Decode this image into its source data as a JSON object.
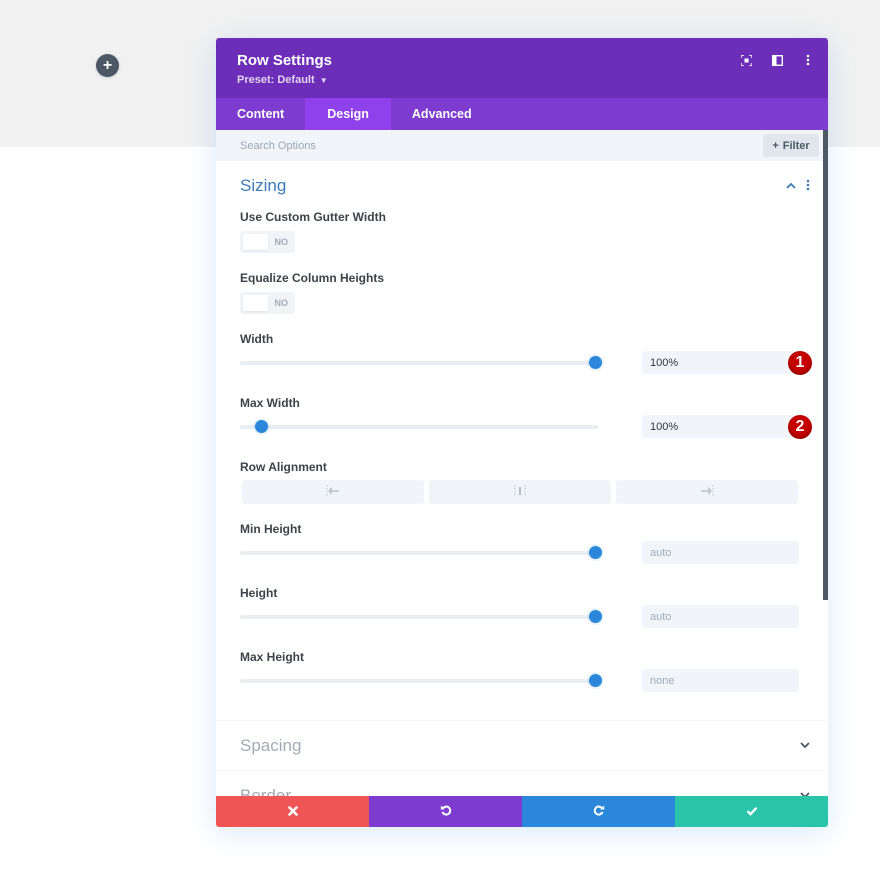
{
  "canvas": {
    "add_row_icon": "plus-icon"
  },
  "panel": {
    "title": "Row Settings",
    "preset_label": "Preset: Default",
    "header_icons": [
      "focus-mode-icon",
      "split-view-icon",
      "more-options-icon"
    ],
    "tabs": [
      {
        "label": "Content",
        "active": false
      },
      {
        "label": "Design",
        "active": true
      },
      {
        "label": "Advanced",
        "active": false
      }
    ],
    "search": {
      "placeholder": "Search Options",
      "value": ""
    },
    "filter_label": "Filter",
    "colors": {
      "header": "#6c2eb9",
      "tabs": "#7d3bcf",
      "active_tab": "#8f42ec",
      "accent": "#2b87da",
      "badge": "#c40000"
    }
  },
  "sizing": {
    "title": "Sizing",
    "expanded": true,
    "custom_gutter": {
      "label": "Use Custom Gutter Width",
      "value": "NO"
    },
    "equalize_columns": {
      "label": "Equalize Column Heights",
      "value": "NO"
    },
    "width": {
      "label": "Width",
      "value": "100%",
      "slider_percent": 100,
      "badge": "1"
    },
    "max_width": {
      "label": "Max Width",
      "value": "100%",
      "slider_percent": 5,
      "badge": "2"
    },
    "row_alignment": {
      "label": "Row Alignment",
      "options": [
        "align-left-icon",
        "align-center-icon",
        "align-right-icon"
      ]
    },
    "min_height": {
      "label": "Min Height",
      "value": "auto",
      "slider_percent": 100
    },
    "height": {
      "label": "Height",
      "value": "auto",
      "slider_percent": 100
    },
    "max_height": {
      "label": "Max Height",
      "value": "none",
      "slider_percent": 100
    }
  },
  "collapsed_sections": [
    {
      "title": "Spacing"
    },
    {
      "title": "Border"
    }
  ],
  "footer": {
    "buttons": [
      {
        "name": "discard",
        "icon": "close-icon",
        "color": "#ef5555"
      },
      {
        "name": "undo",
        "icon": "undo-icon",
        "color": "#7e3bd0"
      },
      {
        "name": "redo",
        "icon": "redo-icon",
        "color": "#2b87da"
      },
      {
        "name": "save",
        "icon": "check-icon",
        "color": "#29c4a9"
      }
    ]
  }
}
